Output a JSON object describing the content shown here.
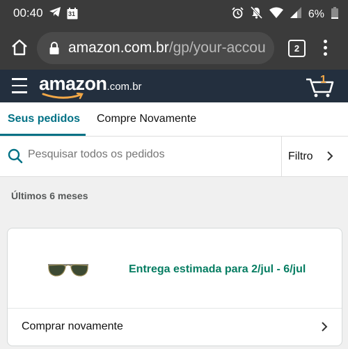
{
  "status_bar": {
    "time": "00:40",
    "calendar_day": "31",
    "battery": "6%",
    "icons": [
      "telegram-icon",
      "calendar-icon",
      "alarm-icon",
      "notifications-off-icon",
      "wifi-icon",
      "signal-icon",
      "battery-icon"
    ]
  },
  "browser": {
    "url_domain": "amazon.com.br",
    "url_path": "/gp/your-accou",
    "tab_count": "2"
  },
  "header": {
    "logo_main": "amazon",
    "logo_suffix": ".com.br",
    "cart_count": "1",
    "accent": "#f3a847",
    "background": "#232f3e"
  },
  "tabs": [
    {
      "label": "Seus pedidos",
      "active": true
    },
    {
      "label": "Compre Novamente",
      "active": false
    }
  ],
  "search": {
    "placeholder": "Pesquisar todos os pedidos",
    "filter_label": "Filtro"
  },
  "period_label": "Últimos 6 meses",
  "orders": [
    {
      "product_icon": "sunglasses-image",
      "delivery_text": "Entrega estimada para 2/jul - 6/jul",
      "action_label": "Comprar novamente"
    }
  ],
  "colors": {
    "teal_active": "#007185",
    "delivery_green": "#067d62"
  }
}
